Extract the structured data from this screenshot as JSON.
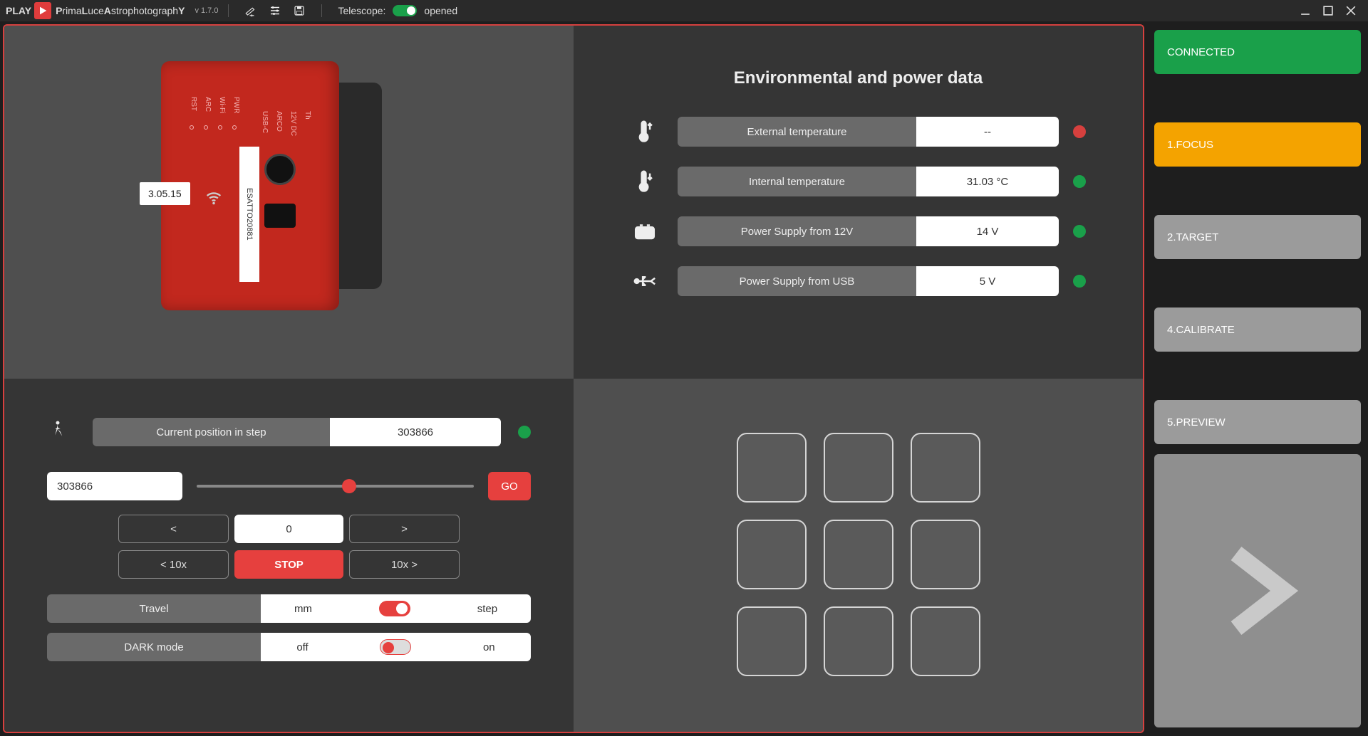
{
  "header": {
    "play": "PLAY",
    "brandPrefix": "P",
    "brandMiddle": "rima",
    "brandL": "L",
    "brandMiddle2": "uce",
    "brandA": "A",
    "brandMiddle3": "strophotograph",
    "brandY": "Y",
    "version": "v 1.7.0",
    "telescope_label": "Telescope:",
    "telescope_state": "opened"
  },
  "device": {
    "firmware": "3.05.15",
    "tag": "ESATTO20881",
    "ports": {
      "usbc": "USB-C",
      "arco": "ARCO",
      "dc12": "12V DC",
      "th": "Th"
    },
    "leds": {
      "pwr": "PWR",
      "wifi": "Wi-Fi",
      "arc": "ARC",
      "rst": "RST"
    }
  },
  "env": {
    "title": "Environmental and power data",
    "rows": [
      {
        "label": "External temperature",
        "value": "--",
        "status": "red"
      },
      {
        "label": "Internal temperature",
        "value": "31.03 °C",
        "status": "green"
      },
      {
        "label": "Power Supply from 12V",
        "value": "14 V",
        "status": "green"
      },
      {
        "label": "Power Supply from USB",
        "value": "5 V",
        "status": "green"
      }
    ]
  },
  "position": {
    "label": "Current position in step",
    "value": "303866",
    "status": "green",
    "target_input": "303866",
    "slider_percent": 55,
    "go": "GO",
    "buttons": {
      "lt": "<",
      "zero": "0",
      "gt": ">",
      "lt10": "< 10x",
      "stop": "STOP",
      "gt10": "10x >"
    },
    "travel": {
      "label": "Travel",
      "left": "mm",
      "right": "step",
      "state": "on"
    },
    "dark": {
      "label": "DARK mode",
      "left": "off",
      "right": "on",
      "state": "off"
    }
  },
  "sidebar": {
    "connected": "CONNECTED",
    "steps": [
      "1.FOCUS",
      "2.TARGET",
      "4.CALIBRATE",
      "5.PREVIEW"
    ],
    "active_index": 0
  },
  "colors": {
    "accent_red": "#e6403e",
    "accent_green": "#1aa04a",
    "accent_orange": "#f4a300"
  }
}
